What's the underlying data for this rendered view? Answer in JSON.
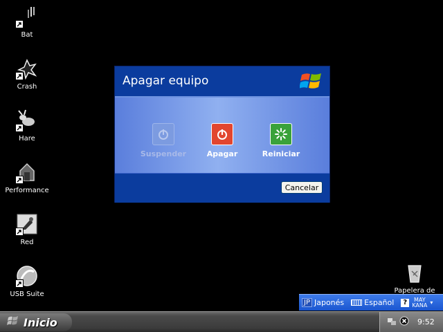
{
  "desktop": {
    "icons": [
      {
        "label": "Bat",
        "icon": "bat-icon"
      },
      {
        "label": "Crash",
        "icon": "crash-icon"
      },
      {
        "label": "Hare",
        "icon": "hare-icon"
      },
      {
        "label": "Performance",
        "icon": "performance-icon"
      },
      {
        "label": "Red",
        "icon": "red-icon"
      },
      {
        "label": "USB Suite",
        "icon": "usb-suite-icon"
      }
    ],
    "recycle_bin": {
      "label": "Papelera de",
      "icon": "recycle-bin-icon"
    }
  },
  "dialog": {
    "title": "Apagar equipo",
    "options": [
      {
        "label": "Suspender",
        "icon": "standby-icon",
        "enabled": false
      },
      {
        "label": "Apagar",
        "icon": "power-off-icon",
        "enabled": true
      },
      {
        "label": "Reiniciar",
        "icon": "restart-icon",
        "enabled": true
      }
    ],
    "cancel_label": "Cancelar"
  },
  "langbar": {
    "code": "JP",
    "language": "Japonés",
    "keyboard": "Español",
    "help": "?",
    "mode_top": "MAY",
    "mode_bottom": "KANA"
  },
  "taskbar": {
    "start_label": "Inicio",
    "clock": "9:52"
  },
  "colors": {
    "dialog_header": "#0b3c9e",
    "dialog_body": "#7fa0ec",
    "power_red": "#e2462f",
    "restart_green": "#3aa23a"
  }
}
